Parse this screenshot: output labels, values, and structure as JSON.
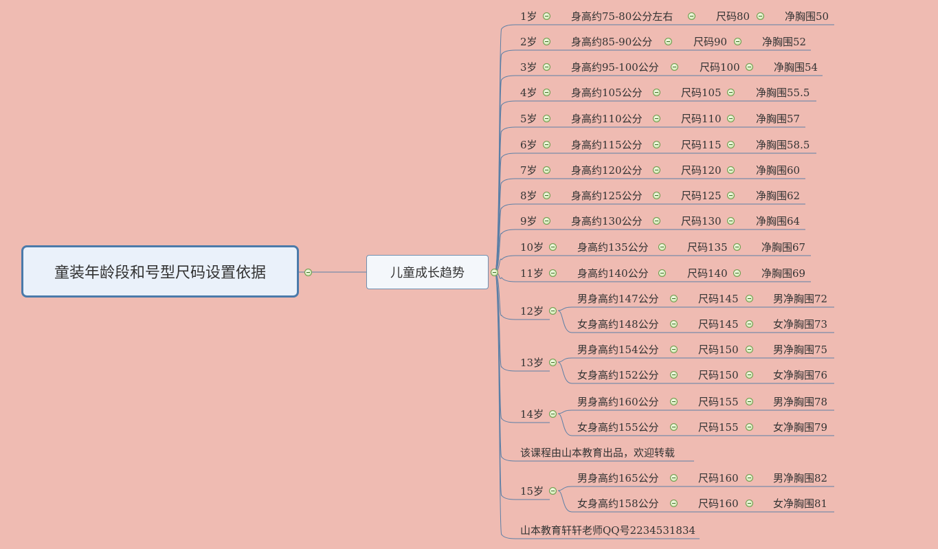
{
  "root": {
    "title": "童装年龄段和号型尺码设置依据"
  },
  "branch": {
    "title": "儿童成长趋势"
  },
  "rows": [
    {
      "age": "1岁",
      "height": "身高约75-80公分左右",
      "size": "尺码80",
      "chest": "净胸围50"
    },
    {
      "age": "2岁",
      "height": "身高约85-90公分",
      "size": "尺码90",
      "chest": "净胸围52"
    },
    {
      "age": "3岁",
      "height": "身高约95-100公分",
      "size": "尺码100",
      "chest": "净胸围54"
    },
    {
      "age": "4岁",
      "height": "身高约105公分",
      "size": "尺码105",
      "chest": "净胸围55.5"
    },
    {
      "age": "5岁",
      "height": "身高约110公分",
      "size": "尺码110",
      "chest": "净胸围57"
    },
    {
      "age": "6岁",
      "height": "身高约115公分",
      "size": "尺码115",
      "chest": "净胸围58.5"
    },
    {
      "age": "7岁",
      "height": "身高约120公分",
      "size": "尺码120",
      "chest": "净胸围60"
    },
    {
      "age": "8岁",
      "height": "身高约125公分",
      "size": "尺码125",
      "chest": "净胸围62"
    },
    {
      "age": "9岁",
      "height": "身高约130公分",
      "size": "尺码130",
      "chest": "净胸围64"
    },
    {
      "age": "10岁",
      "height": "身高约135公分",
      "size": "尺码135",
      "chest": "净胸围67"
    },
    {
      "age": "11岁",
      "height": "身高约140公分",
      "size": "尺码140",
      "chest": "净胸围69"
    }
  ],
  "groups": [
    {
      "age": "12岁",
      "items": [
        {
          "height": "男身高约147公分",
          "size": "尺码145",
          "chest": "男净胸围72"
        },
        {
          "height": "女身高约148公分",
          "size": "尺码145",
          "chest": "女净胸围73"
        }
      ]
    },
    {
      "age": "13岁",
      "items": [
        {
          "height": "男身高约154公分",
          "size": "尺码150",
          "chest": "男净胸围75"
        },
        {
          "height": "女身高约152公分",
          "size": "尺码150",
          "chest": "女净胸围76"
        }
      ]
    },
    {
      "age": "14岁",
      "items": [
        {
          "height": "男身高约160公分",
          "size": "尺码155",
          "chest": "男净胸围78"
        },
        {
          "height": "女身高约155公分",
          "size": "尺码155",
          "chest": "女净胸围79"
        }
      ]
    },
    {
      "age": "15岁",
      "items": [
        {
          "height": "男身高约165公分",
          "size": "尺码160",
          "chest": "男净胸围82"
        },
        {
          "height": "女身高约158公分",
          "size": "尺码160",
          "chest": "女净胸围81"
        }
      ]
    }
  ],
  "notes": {
    "course": "该课程由山本教育出品，欢迎转载",
    "contact": "山本教育轩轩老师QQ号2234531834"
  },
  "colors": {
    "background": "#EFBBB2",
    "line": "#5B7FA6",
    "toggle": "#C6E2A2"
  }
}
